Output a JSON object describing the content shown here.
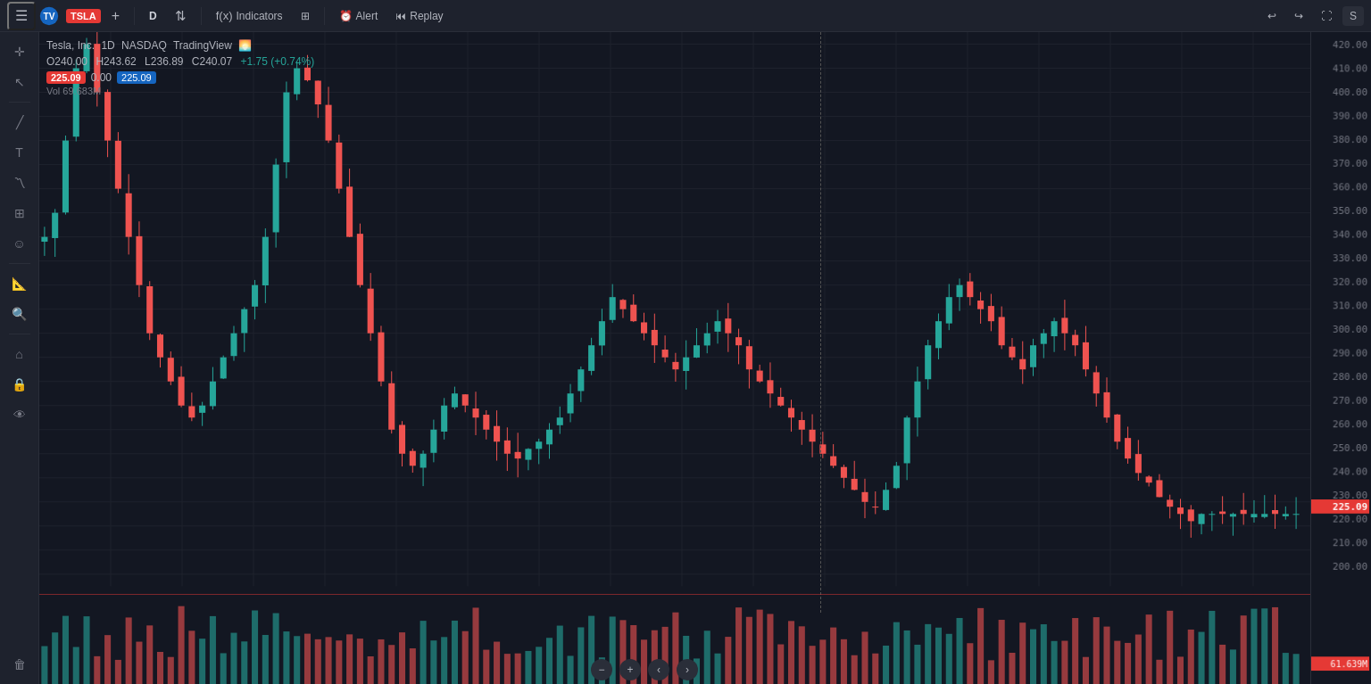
{
  "topbar": {
    "logo_alt": "TradingView",
    "menu_icon": "☰",
    "ticker": "TSLA",
    "add_chart": "+",
    "timeframe": "D",
    "compare": "⇅",
    "indicators_label": "Indicators",
    "layout_icon": "⊞",
    "alert_label": "Alert",
    "replay_label": "Replay",
    "undo_icon": "↩",
    "redo_icon": "↪",
    "fullscreen_icon": "⛶",
    "more_icon": "S"
  },
  "chart_info": {
    "ticker": "Tesla, Inc.",
    "timeframe": "1D",
    "exchange": "NASDAQ",
    "source": "TradingView",
    "open": "O240.00",
    "high": "H243.62",
    "low": "L236.89",
    "close": "C240.07",
    "change": "+1.75 (+0.74%)",
    "current_price": "225.09",
    "delta": "0.00",
    "price_tag": "225.09",
    "vol_label": "Vol",
    "vol_value": "69.683M"
  },
  "price_axis": {
    "labels": [
      "420.00",
      "410.00",
      "400.00",
      "390.00",
      "380.00",
      "370.00",
      "360.00",
      "350.00",
      "340.00",
      "330.00",
      "320.00",
      "310.00",
      "300.00",
      "290.00",
      "280.00",
      "270.00",
      "260.00",
      "250.00",
      "240.00",
      "230.00",
      "220.00",
      "210.00",
      "200.00"
    ],
    "current": "225.09",
    "vol_badge": "61.639M"
  },
  "toolbar": {
    "items": [
      {
        "icon": "✛",
        "name": "crosshair"
      },
      {
        "icon": "↖",
        "name": "pointer"
      },
      {
        "icon": "✏️",
        "name": "draw-line"
      },
      {
        "icon": "T",
        "name": "text"
      },
      {
        "icon": "〽",
        "name": "path"
      },
      {
        "icon": "⊞",
        "name": "patterns"
      },
      {
        "icon": "☺",
        "name": "emoji"
      },
      {
        "icon": "📐",
        "name": "measure"
      },
      {
        "icon": "🔍",
        "name": "zoom"
      },
      {
        "icon": "⌂",
        "name": "chart-type"
      },
      {
        "icon": "📌",
        "name": "pin"
      },
      {
        "icon": "🗑",
        "name": "trash"
      }
    ]
  },
  "bottom_nav": {
    "zoom_out": "−",
    "zoom_in": "+",
    "scroll_left": "‹",
    "scroll_right": "›"
  },
  "colors": {
    "bull": "#26a69a",
    "bear": "#ef5350",
    "bg": "#131722",
    "panel": "#1e222d",
    "grid": "#1e222d",
    "dashed_line": "#555555"
  }
}
